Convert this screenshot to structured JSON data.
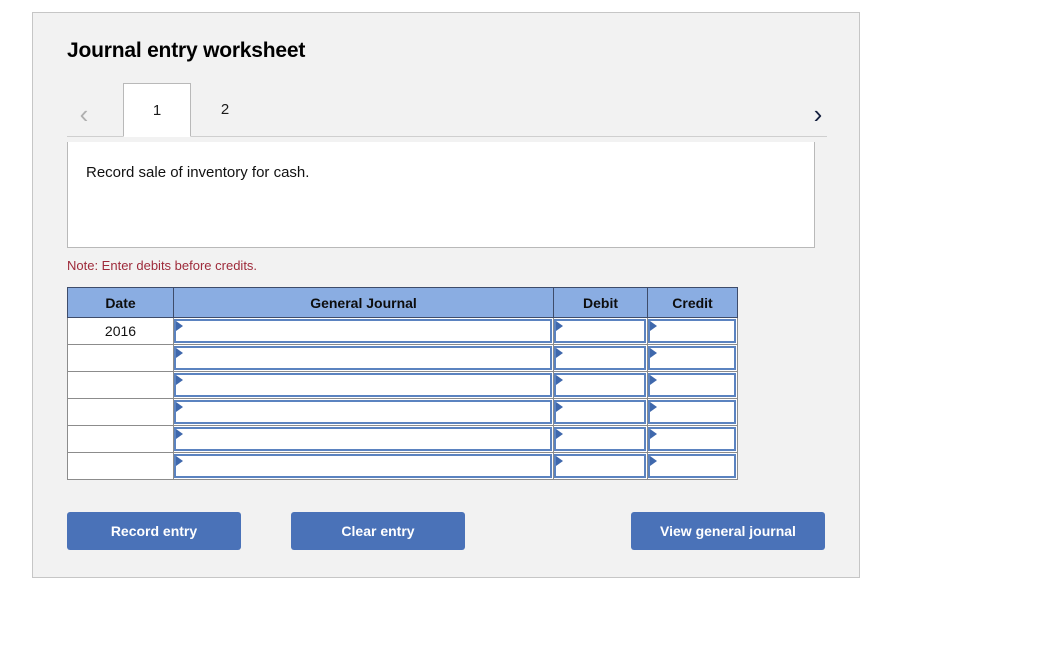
{
  "panel": {
    "title": "Journal entry worksheet"
  },
  "tabs": {
    "prev_icon": "chevron-left-icon",
    "next_icon": "chevron-right-icon",
    "items": [
      {
        "label": "1",
        "active": true
      },
      {
        "label": "2",
        "active": false
      }
    ]
  },
  "description": {
    "text": "Record sale of inventory for cash."
  },
  "note": {
    "text": "Note: Enter debits before credits."
  },
  "table": {
    "columns": [
      "Date",
      "General Journal",
      "Debit",
      "Credit"
    ],
    "rows": [
      {
        "date": "2016",
        "general_journal": "",
        "debit": "",
        "credit": ""
      },
      {
        "date": "",
        "general_journal": "",
        "debit": "",
        "credit": ""
      },
      {
        "date": "",
        "general_journal": "",
        "debit": "",
        "credit": ""
      },
      {
        "date": "",
        "general_journal": "",
        "debit": "",
        "credit": ""
      },
      {
        "date": "",
        "general_journal": "",
        "debit": "",
        "credit": ""
      },
      {
        "date": "",
        "general_journal": "",
        "debit": "",
        "credit": ""
      }
    ]
  },
  "buttons": {
    "record": "Record entry",
    "clear": "Clear entry",
    "view": "View general journal"
  },
  "colors": {
    "header_blue": "#8aade2",
    "button_blue": "#4a72b8",
    "input_border_blue": "#5b83c0",
    "note_red": "#9e2a3a",
    "panel_bg": "#f2f2f2"
  }
}
